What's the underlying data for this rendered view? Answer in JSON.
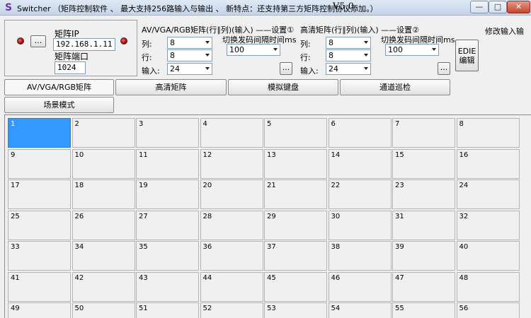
{
  "titlebar": {
    "app_icon": "S",
    "title": "Switcher  （矩阵控制软件 、 最大支持256路输入与输出 、 新特点：还支持第三方矩阵控制协议添加。）",
    "version": "V5.0",
    "min_symbol": "—",
    "max_symbol": "□",
    "close_symbol": "✕"
  },
  "connection": {
    "ip_label": "矩阵IP",
    "ip_value": "192.168.1.11",
    "port_label": "矩阵端口",
    "port_value": "1024",
    "browse_label": "...",
    "led_icons": [
      "status-led-icon",
      "status-led-icon"
    ]
  },
  "av_panel": {
    "title": "AV/VGA/RGB矩阵(行∥列)(输入) ——设置①",
    "interval_label": "切换发码间隔时间ms",
    "interval_value": "100",
    "col_label": "列:",
    "col_value": "8",
    "row_label": "行:",
    "row_value": "8",
    "input_label": "输入:",
    "input_value": "24",
    "browse_label": "..."
  },
  "hd_panel": {
    "title": "高清矩阵(行∥列)(输入) ——设置②",
    "interval_label": "切换发码间隔时间ms",
    "interval_value": "100",
    "col_label": "列:",
    "col_value": "8",
    "row_label": "行:",
    "row_value": "8",
    "input_label": "输入:",
    "input_value": "24",
    "browse_label": "...",
    "edit_line1": "EDIE",
    "edit_line2": "编辑"
  },
  "modify_input_label": "修改输入输",
  "tabs": [
    {
      "label": "AV/VGA/RGB矩阵"
    },
    {
      "label": "高清矩阵"
    },
    {
      "label": "模拟键盘"
    },
    {
      "label": "通道巡检"
    },
    {
      "label": "场景模式"
    }
  ],
  "grid": {
    "cells": [
      "1",
      "2",
      "3",
      "4",
      "5",
      "6",
      "7",
      "8",
      "9",
      "10",
      "11",
      "12",
      "13",
      "14",
      "15",
      "16",
      "17",
      "18",
      "19",
      "20",
      "21",
      "22",
      "23",
      "24",
      "25",
      "26",
      "27",
      "28",
      "29",
      "30",
      "31",
      "32",
      "33",
      "34",
      "35",
      "36",
      "37",
      "38",
      "39",
      "40",
      "41",
      "42",
      "43",
      "44",
      "45",
      "46",
      "47",
      "48",
      "49",
      "50",
      "51",
      "52",
      "53",
      "54",
      "55",
      "56"
    ],
    "selected": "1"
  }
}
